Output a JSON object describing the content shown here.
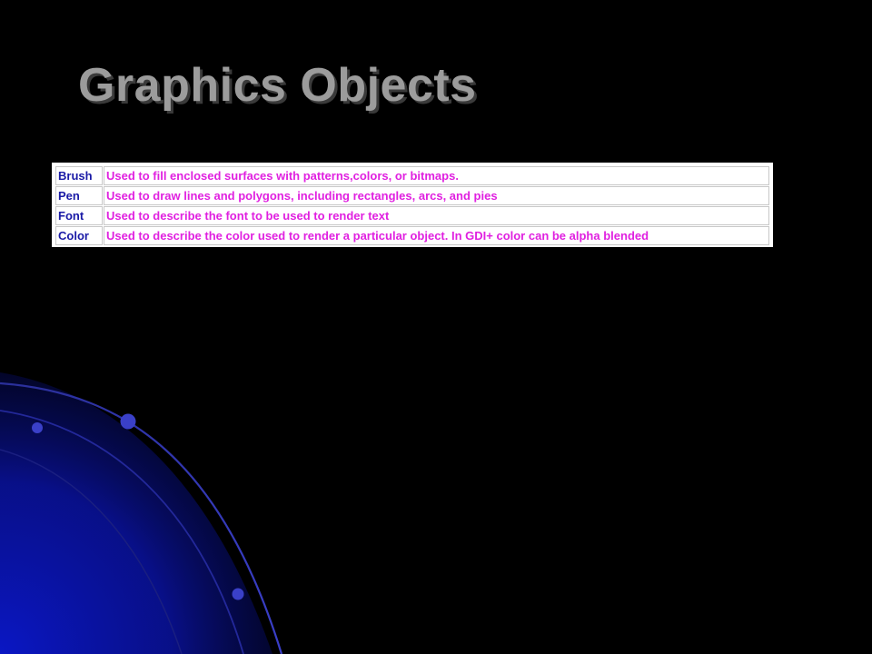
{
  "slide": {
    "title": "Graphics Objects"
  },
  "colors": {
    "background": "#000000",
    "title": "#9c9c9c",
    "name_text": "#1a1aa6",
    "description_text": "#e020e0",
    "decor_blue": "#0a17c4"
  },
  "table": {
    "rows": [
      {
        "name": "Brush",
        "description": "Used to fill enclosed surfaces with patterns,colors, or bitmaps."
      },
      {
        "name": "Pen",
        "description": "Used to draw lines and polygons, including rectangles, arcs, and pies"
      },
      {
        "name": "Font",
        "description": "Used to describe the font to be used to render text"
      },
      {
        "name": "Color",
        "description": "Used to describe the color used to render a particular object. In GDI+ color can be alpha blended"
      }
    ]
  }
}
